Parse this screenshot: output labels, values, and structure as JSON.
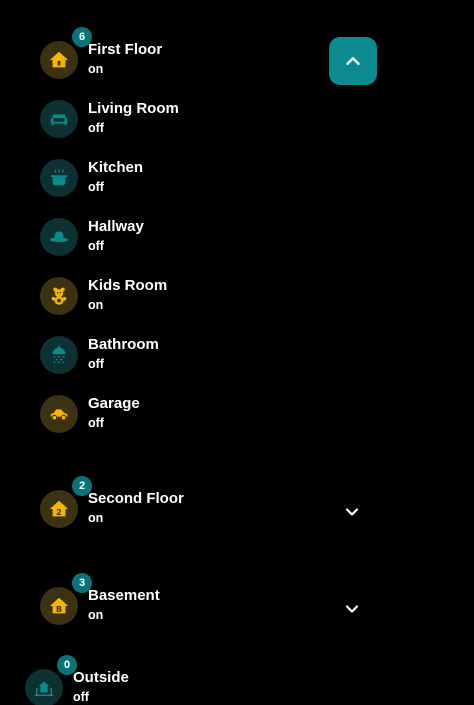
{
  "colors": {
    "accent": "#0b8a8f",
    "badge": "#0a7378",
    "on_icon": "#f5b600",
    "off_icon": "#0a8a8a"
  },
  "scroll_top_button": {
    "icon": "chevron-up-icon"
  },
  "floors": [
    {
      "name": "First Floor",
      "state": "on",
      "badge": "6",
      "icon": "home-icon",
      "expanded": true,
      "rooms": [
        {
          "name": "Living Room",
          "state": "off",
          "icon": "sofa-icon"
        },
        {
          "name": "Kitchen",
          "state": "off",
          "icon": "pot-steam-icon"
        },
        {
          "name": "Hallway",
          "state": "off",
          "icon": "hat-icon"
        },
        {
          "name": "Kids Room",
          "state": "on",
          "icon": "teddy-bear-icon"
        },
        {
          "name": "Bathroom",
          "state": "off",
          "icon": "shower-icon"
        },
        {
          "name": "Garage",
          "state": "off",
          "icon": "car-icon"
        }
      ]
    },
    {
      "name": "Second Floor",
      "state": "on",
      "badge": "2",
      "icon": "home-number-2-icon",
      "expanded": false,
      "toggle_icon": "chevron-down-icon"
    },
    {
      "name": "Basement",
      "state": "on",
      "badge": "3",
      "icon": "home-letter-b-icon",
      "expanded": false,
      "toggle_icon": "chevron-down-icon"
    },
    {
      "name": "Outside",
      "state": "off",
      "badge": "0",
      "icon": "home-outside-icon"
    }
  ]
}
